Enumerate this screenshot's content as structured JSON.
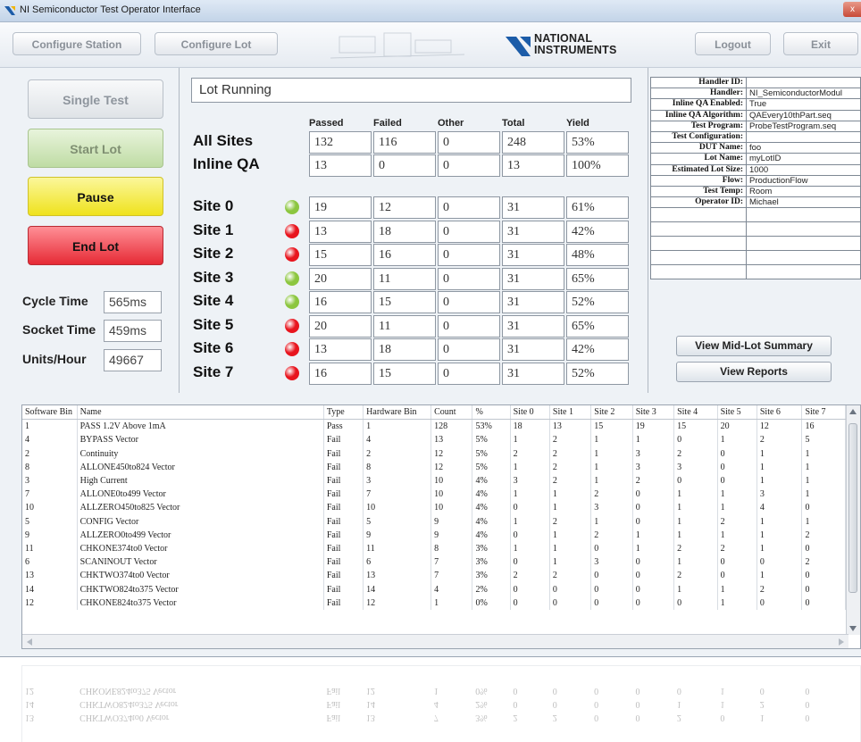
{
  "window": {
    "title": "NI Semiconductor Test Operator Interface",
    "close_label": "x"
  },
  "toolbar": {
    "configure_station": "Configure Station",
    "configure_lot": "Configure Lot",
    "logo_line1": "NATIONAL",
    "logo_line2": "INSTRUMENTS",
    "logout": "Logout",
    "exit": "Exit"
  },
  "controls": {
    "single_test": "Single Test",
    "start_lot": "Start Lot",
    "pause": "Pause",
    "end_lot": "End Lot"
  },
  "stats": {
    "cycle_time_label": "Cycle Time",
    "cycle_time_value": "565ms",
    "socket_time_label": "Socket Time",
    "socket_time_value": "459ms",
    "units_hour_label": "Units/Hour",
    "units_hour_value": "49667"
  },
  "status": "Lot Running",
  "results": {
    "columns": [
      "Passed",
      "Failed",
      "Other",
      "Total",
      "Yield"
    ],
    "summary_rows": [
      {
        "label": "All Sites",
        "values": [
          "132",
          "116",
          "0",
          "248",
          "53%"
        ]
      },
      {
        "label": "Inline QA",
        "values": [
          "13",
          "0",
          "0",
          "13",
          "100%"
        ]
      }
    ],
    "site_rows": [
      {
        "label": "Site 0",
        "status": "pass",
        "values": [
          "19",
          "12",
          "0",
          "31",
          "61%"
        ]
      },
      {
        "label": "Site 1",
        "status": "fail",
        "values": [
          "13",
          "18",
          "0",
          "31",
          "42%"
        ]
      },
      {
        "label": "Site 2",
        "status": "fail",
        "values": [
          "15",
          "16",
          "0",
          "31",
          "48%"
        ]
      },
      {
        "label": "Site 3",
        "status": "pass",
        "values": [
          "20",
          "11",
          "0",
          "31",
          "65%"
        ]
      },
      {
        "label": "Site 4",
        "status": "pass",
        "values": [
          "16",
          "15",
          "0",
          "31",
          "52%"
        ]
      },
      {
        "label": "Site 5",
        "status": "fail",
        "values": [
          "20",
          "11",
          "0",
          "31",
          "65%"
        ]
      },
      {
        "label": "Site 6",
        "status": "fail",
        "values": [
          "13",
          "18",
          "0",
          "31",
          "42%"
        ]
      },
      {
        "label": "Site 7",
        "status": "fail",
        "values": [
          "16",
          "15",
          "0",
          "31",
          "52%"
        ]
      }
    ],
    "colors": {
      "pass": "#8cc63f",
      "fail": "#e8151e"
    }
  },
  "lot_info": [
    {
      "key": "Handler ID:",
      "value": ""
    },
    {
      "key": "Handler:",
      "value": "NI_SemiconductorModul"
    },
    {
      "key": "Inline QA Enabled:",
      "value": "True"
    },
    {
      "key": "Inline QA Algorithm:",
      "value": "QAEvery10thPart.seq"
    },
    {
      "key": "Test Program:",
      "value": "ProbeTestProgram.seq"
    },
    {
      "key": "Test Configuration:",
      "value": ""
    },
    {
      "key": "DUT Name:",
      "value": "foo"
    },
    {
      "key": "Lot Name:",
      "value": "myLotID"
    },
    {
      "key": "Estimated Lot Size:",
      "value": "1000"
    },
    {
      "key": "Flow:",
      "value": "ProductionFlow"
    },
    {
      "key": "Test Temp:",
      "value": "Room"
    },
    {
      "key": "Operator ID:",
      "value": "Michael"
    }
  ],
  "lot_buttons": {
    "view_mid_lot_summary": "View Mid-Lot Summary",
    "view_reports": "View Reports"
  },
  "bin_table": {
    "headers": [
      "Software Bin",
      "Name",
      "Type",
      "Hardware Bin",
      "Count",
      "%",
      "Site 0",
      "Site 1",
      "Site 2",
      "Site 3",
      "Site 4",
      "Site 5",
      "Site 6",
      "Site 7"
    ],
    "rows": [
      [
        "1",
        "PASS 1.2V Above 1mA",
        "Pass",
        "1",
        "128",
        "53%",
        "18",
        "13",
        "15",
        "19",
        "15",
        "20",
        "12",
        "16"
      ],
      [
        "4",
        "BYPASS Vector",
        "Fail",
        "4",
        "13",
        "5%",
        "1",
        "2",
        "1",
        "1",
        "0",
        "1",
        "2",
        "5"
      ],
      [
        "2",
        "Continuity",
        "Fail",
        "2",
        "12",
        "5%",
        "2",
        "2",
        "1",
        "3",
        "2",
        "0",
        "1",
        "1"
      ],
      [
        "8",
        "ALLONE450to824 Vector",
        "Fail",
        "8",
        "12",
        "5%",
        "1",
        "2",
        "1",
        "3",
        "3",
        "0",
        "1",
        "1"
      ],
      [
        "3",
        "High Current",
        "Fail",
        "3",
        "10",
        "4%",
        "3",
        "2",
        "1",
        "2",
        "0",
        "0",
        "1",
        "1"
      ],
      [
        "7",
        "ALLONE0to499 Vector",
        "Fail",
        "7",
        "10",
        "4%",
        "1",
        "1",
        "2",
        "0",
        "1",
        "1",
        "3",
        "1"
      ],
      [
        "10",
        "ALLZERO450to825 Vector",
        "Fail",
        "10",
        "10",
        "4%",
        "0",
        "1",
        "3",
        "0",
        "1",
        "1",
        "4",
        "0"
      ],
      [
        "5",
        "CONFIG Vector",
        "Fail",
        "5",
        "9",
        "4%",
        "1",
        "2",
        "1",
        "0",
        "1",
        "2",
        "1",
        "1"
      ],
      [
        "9",
        "ALLZERO0to499 Vector",
        "Fail",
        "9",
        "9",
        "4%",
        "0",
        "1",
        "2",
        "1",
        "1",
        "1",
        "1",
        "2"
      ],
      [
        "11",
        "CHKONE374to0 Vector",
        "Fail",
        "11",
        "8",
        "3%",
        "1",
        "1",
        "0",
        "1",
        "2",
        "2",
        "1",
        "0"
      ],
      [
        "6",
        "SCANINOUT Vector",
        "Fail",
        "6",
        "7",
        "3%",
        "0",
        "1",
        "3",
        "0",
        "1",
        "0",
        "0",
        "2"
      ],
      [
        "13",
        "CHKTWO374to0 Vector",
        "Fail",
        "13",
        "7",
        "3%",
        "2",
        "2",
        "0",
        "0",
        "2",
        "0",
        "1",
        "0"
      ],
      [
        "14",
        "CHKTWO824to375 Vector",
        "Fail",
        "14",
        "4",
        "2%",
        "0",
        "0",
        "0",
        "0",
        "1",
        "1",
        "2",
        "0"
      ],
      [
        "12",
        "CHKONE824to375 Vector",
        "Fail",
        "12",
        "1",
        "0%",
        "0",
        "0",
        "0",
        "0",
        "0",
        "1",
        "0",
        "0"
      ]
    ],
    "reflection_rows": [
      [
        "12",
        "CHKONE824to375 Vector",
        "Fail",
        "12",
        "1",
        "0%",
        "0",
        "0",
        "0",
        "0",
        "0",
        "1",
        "0",
        "0"
      ],
      [
        "14",
        "CHKTWO824to375 Vector",
        "Fail",
        "14",
        "4",
        "2%",
        "0",
        "0",
        "0",
        "0",
        "1",
        "1",
        "2",
        "0"
      ],
      [
        "13",
        "CHKTWO374to0 Vector",
        "Fail",
        "13",
        "7",
        "3%",
        "2",
        "2",
        "0",
        "0",
        "2",
        "0",
        "1",
        "0"
      ]
    ]
  }
}
